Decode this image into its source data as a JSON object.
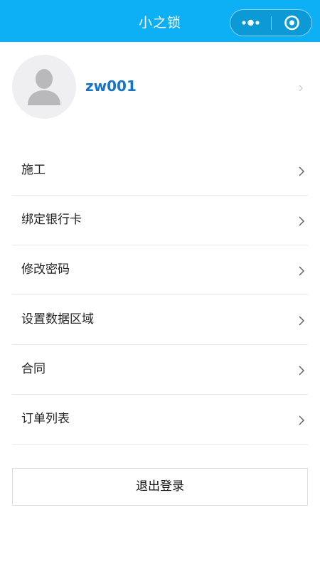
{
  "nav": {
    "title": "小之锁",
    "more_icon": "more-dots-icon",
    "close_icon": "target-circle-icon",
    "bg_color": "#0db0f4"
  },
  "profile": {
    "username": "zw001",
    "avatar_icon": "default-avatar-icon",
    "username_color": "#1775c9"
  },
  "menu": {
    "items": [
      {
        "label": "施工"
      },
      {
        "label": "绑定银行卡"
      },
      {
        "label": "修改密码"
      },
      {
        "label": "设置数据区域"
      },
      {
        "label": "合同"
      },
      {
        "label": "订单列表"
      }
    ],
    "chevron_icon": "chevron-right-icon"
  },
  "logout": {
    "label": "退出登录"
  }
}
